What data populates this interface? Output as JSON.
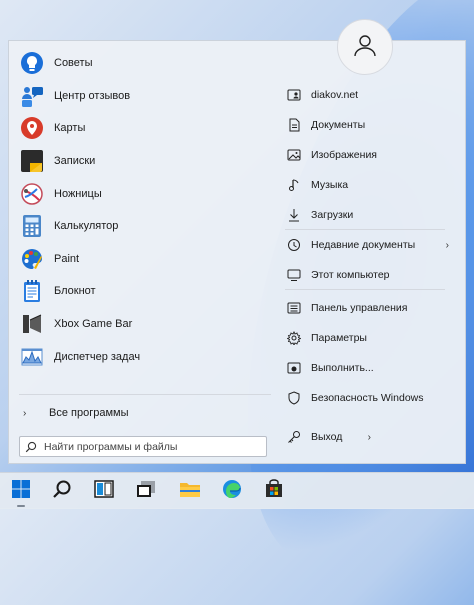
{
  "start_menu": {
    "apps": [
      {
        "label": "Советы",
        "icon": "tips-bulb-icon"
      },
      {
        "label": "Центр отзывов",
        "icon": "feedback-hub-icon"
      },
      {
        "label": "Карты",
        "icon": "maps-pin-icon"
      },
      {
        "label": "Записки",
        "icon": "sticky-notes-icon"
      },
      {
        "label": "Ножницы",
        "icon": "snipping-tool-icon"
      },
      {
        "label": "Калькулятор",
        "icon": "calculator-icon"
      },
      {
        "label": "Paint",
        "icon": "paint-palette-icon"
      },
      {
        "label": "Блокнот",
        "icon": "notepad-icon"
      },
      {
        "label": "Xbox Game Bar",
        "icon": "xbox-game-bar-icon"
      },
      {
        "label": "Диспетчер задач",
        "icon": "task-manager-icon"
      }
    ],
    "all_programs_label": "Все программы",
    "search_placeholder": "Найти программы и файлы",
    "places": [
      {
        "label": "diakov.net",
        "icon": "user-folder-icon"
      },
      {
        "label": "Документы",
        "icon": "documents-icon"
      },
      {
        "label": "Изображения",
        "icon": "pictures-icon"
      },
      {
        "label": "Музыка",
        "icon": "music-icon"
      },
      {
        "label": "Загрузки",
        "icon": "downloads-icon"
      },
      {
        "label": "Недавние документы",
        "icon": "recent-clock-icon"
      },
      {
        "label": "Этот компьютер",
        "icon": "computer-icon"
      },
      {
        "label": "Панель управления",
        "icon": "control-panel-icon"
      },
      {
        "label": "Параметры",
        "icon": "settings-gear-icon"
      },
      {
        "label": "Выполнить...",
        "icon": "run-icon"
      },
      {
        "label": "Безопасность Windows",
        "icon": "shield-icon"
      }
    ],
    "exit_label": "Выход"
  },
  "taskbar": {
    "items": [
      "start-windows-icon",
      "search-icon",
      "snap-layout-icon",
      "desktop-icon",
      "file-explorer-icon",
      "edge-browser-icon",
      "store-icon"
    ]
  },
  "colors": {
    "accent": "#0067c0",
    "menu_bg": "#ecf0f6"
  }
}
